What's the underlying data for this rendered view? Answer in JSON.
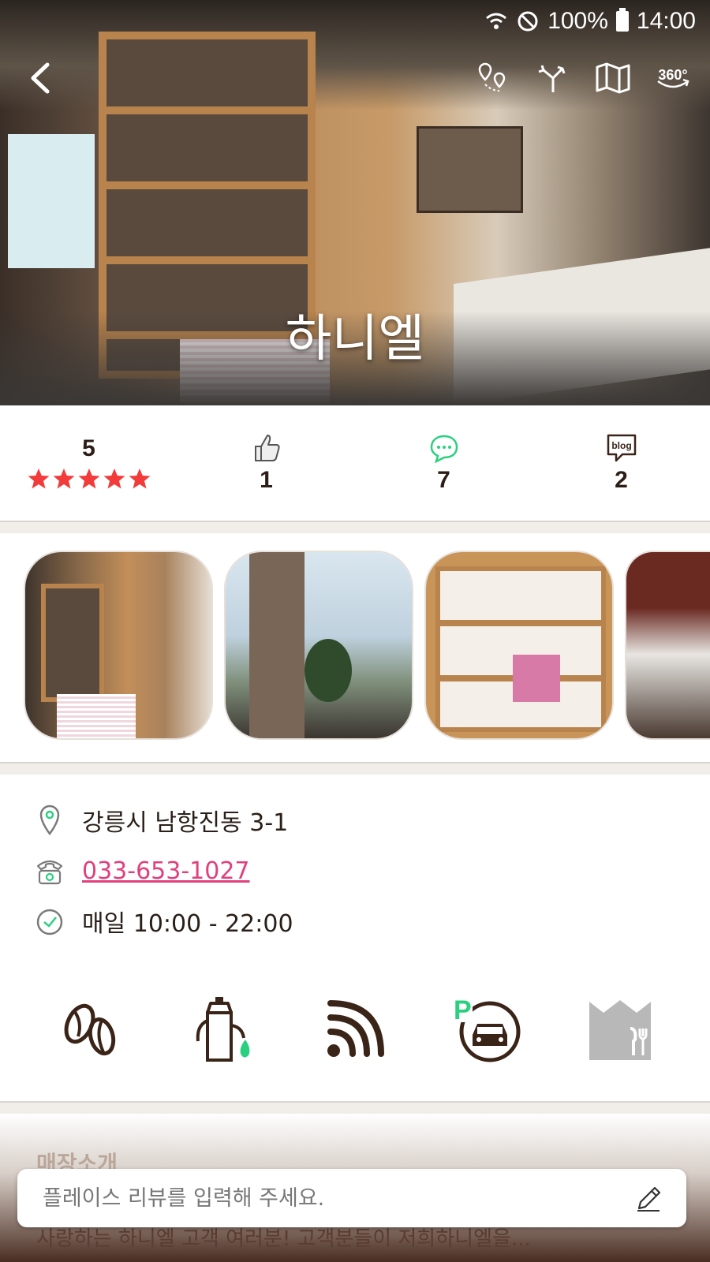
{
  "status_bar": {
    "battery": "100%",
    "time": "14:00"
  },
  "hero": {
    "title": "하니엘"
  },
  "toolbar": {
    "icons": [
      "location-pin-icon",
      "directions-icon",
      "map-icon",
      "360-view-icon"
    ],
    "label_360": "360°"
  },
  "stats": {
    "rating": "5",
    "stars": 5,
    "likes": "1",
    "comments": "7",
    "blogs": "2",
    "blog_badge": "blog"
  },
  "gallery": {
    "photo_count": 4
  },
  "info": {
    "address": "강릉시 남항진동 3-1",
    "phone": "033-653-1027",
    "hours": "매일 10:00 - 22:00"
  },
  "amenities": [
    "coffee-beans-icon",
    "drip-kettle-icon",
    "wifi-icon",
    "parking-icon",
    "premium-dining-icon"
  ],
  "colors": {
    "accent": "#e2407d",
    "star": "#f23c3c",
    "green": "#2bd07e",
    "brown": "#3a2418"
  },
  "intro": {
    "title": "매장소개",
    "text": "사랑하는 하니엘 고객 여러분! 고객분들이 저희하니엘을..."
  },
  "review": {
    "placeholder": "플레이스 리뷰를 입력해 주세요."
  }
}
